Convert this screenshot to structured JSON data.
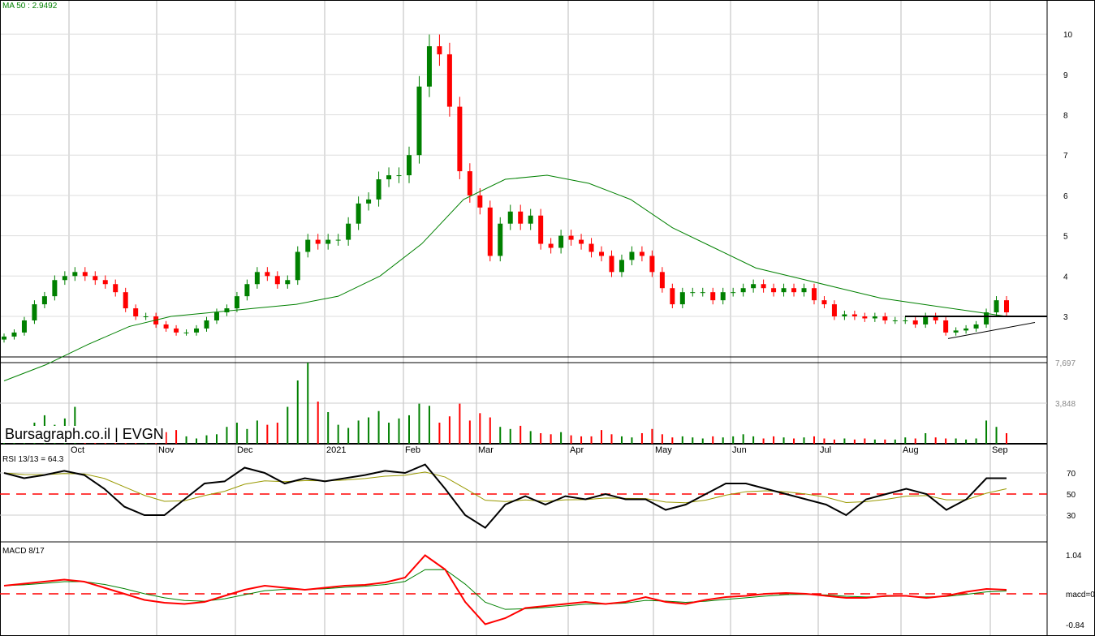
{
  "header": {
    "ma_label": "MA 50 : 2.9492",
    "watermark": "Bursagraph.co.il | EVGN"
  },
  "colors": {
    "up": "#008000",
    "down": "#ff0000",
    "ma": "#008000",
    "rsi": "#000000",
    "rsi_signal": "#999900",
    "macd": "#ff0000",
    "macd_signal": "#008000",
    "grid": "#bbbbbb"
  },
  "chart_data": [
    {
      "type": "candlestick",
      "title": "EVGN",
      "x_tick_labels": [
        "Oct",
        "Nov",
        "Dec",
        "2021",
        "Feb",
        "Mar",
        "Apr",
        "May",
        "Jun",
        "Jul",
        "Aug",
        "Sep"
      ],
      "y_tick_labels": [
        "3",
        "4",
        "5",
        "6",
        "7",
        "8",
        "9",
        "10"
      ],
      "ylim": [
        1.0,
        10.85
      ],
      "close": [
        2.5,
        2.6,
        2.9,
        3.3,
        3.5,
        3.9,
        4.0,
        4.1,
        4.0,
        3.9,
        3.8,
        3.6,
        3.2,
        3.0,
        3.0,
        2.8,
        2.7,
        2.6,
        2.6,
        2.7,
        2.9,
        3.1,
        3.2,
        3.5,
        3.8,
        4.1,
        4.0,
        3.8,
        3.9,
        4.6,
        4.9,
        4.8,
        4.9,
        4.9,
        5.3,
        5.8,
        5.9,
        6.4,
        6.5,
        6.5,
        7.0,
        8.7,
        9.7,
        9.5,
        8.2,
        6.6,
        6.0,
        5.7,
        4.5,
        5.3,
        5.6,
        5.3,
        5.5,
        4.8,
        4.7,
        5.0,
        4.9,
        4.8,
        4.6,
        4.5,
        4.1,
        4.4,
        4.6,
        4.5,
        4.1,
        3.7,
        3.3,
        3.6,
        3.6,
        3.6,
        3.4,
        3.6,
        3.6,
        3.7,
        3.8,
        3.7,
        3.6,
        3.7,
        3.6,
        3.7,
        3.4,
        3.3,
        3.0,
        3.05,
        3.0,
        2.95,
        3.0,
        2.9,
        2.9,
        2.9,
        2.8,
        3.0,
        2.9,
        2.6,
        2.65,
        2.7,
        2.8,
        3.1,
        3.4,
        3.1
      ],
      "ma50": [
        1.4,
        1.8,
        2.3,
        2.75,
        3.0,
        3.1,
        3.2,
        3.3,
        3.5,
        4.0,
        4.8,
        5.9,
        6.4,
        6.5,
        6.3,
        5.9,
        5.2,
        4.7,
        4.2,
        3.95,
        3.7,
        3.45,
        3.3,
        3.15,
        3.0
      ],
      "support_level": 3.0,
      "trendline": [
        2.45,
        2.85
      ]
    },
    {
      "type": "bar",
      "title": "Volume",
      "y_tick_labels": [
        "7,697",
        "3,848"
      ],
      "ylim": [
        0,
        7697
      ],
      "values": [
        900,
        1100,
        1500,
        2000,
        2700,
        1800,
        2400,
        3500,
        1500,
        1600,
        1000,
        1200,
        600,
        500,
        400,
        900,
        1100,
        1300,
        700,
        500,
        800,
        900,
        1600,
        2000,
        1400,
        2200,
        1800,
        2000,
        3500,
        6000,
        7697,
        4000,
        3000,
        1800,
        1500,
        2200,
        2500,
        3100,
        2000,
        2400,
        2700,
        3800,
        3600,
        2000,
        2600,
        3800,
        2200,
        2900,
        2500,
        1600,
        1400,
        1700,
        1200,
        1000,
        900,
        1100,
        800,
        700,
        700,
        1300,
        900,
        700,
        600,
        1000,
        1400,
        900,
        600,
        700,
        600,
        500,
        700,
        600,
        700,
        900,
        700,
        500,
        700,
        600,
        500,
        600,
        700,
        500,
        400,
        500,
        400,
        500,
        400,
        400,
        400,
        600,
        500,
        1000,
        600,
        500,
        500,
        400,
        500,
        2200,
        1600,
        1000
      ]
    },
    {
      "type": "line",
      "title": "RSI 13/13 = 64.3",
      "y_tick_labels": [
        "70",
        "50",
        "30"
      ],
      "ylim": [
        0,
        100
      ],
      "reference": 50,
      "values": [
        70,
        65,
        68,
        72,
        68,
        55,
        38,
        30,
        30,
        45,
        60,
        62,
        75,
        70,
        60,
        65,
        62,
        65,
        68,
        72,
        70,
        78,
        55,
        30,
        18,
        40,
        48,
        40,
        48,
        45,
        50,
        45,
        45,
        35,
        40,
        50,
        60,
        60,
        55,
        50,
        45,
        40,
        30,
        45,
        50,
        55,
        50,
        35,
        45,
        65,
        65
      ]
    },
    {
      "type": "line",
      "title": "MACD 8/17",
      "y_tick_labels": [
        "1.04",
        "macd=0",
        "-0.84"
      ],
      "ylim": [
        -0.84,
        1.04
      ],
      "reference": 0,
      "values": [
        0.2,
        0.25,
        0.3,
        0.35,
        0.3,
        0.15,
        0,
        -0.15,
        -0.22,
        -0.25,
        -0.2,
        -0.05,
        0.1,
        0.2,
        0.15,
        0.1,
        0.15,
        0.2,
        0.22,
        0.28,
        0.4,
        0.95,
        0.6,
        -0.2,
        -0.75,
        -0.6,
        -0.35,
        -0.3,
        -0.25,
        -0.2,
        -0.25,
        -0.2,
        -0.08,
        -0.2,
        -0.25,
        -0.15,
        -0.08,
        -0.05,
        0,
        0.02,
        0,
        -0.05,
        -0.1,
        -0.1,
        -0.05,
        -0.05,
        -0.1,
        -0.05,
        0.05,
        0.12,
        0.1
      ]
    }
  ]
}
